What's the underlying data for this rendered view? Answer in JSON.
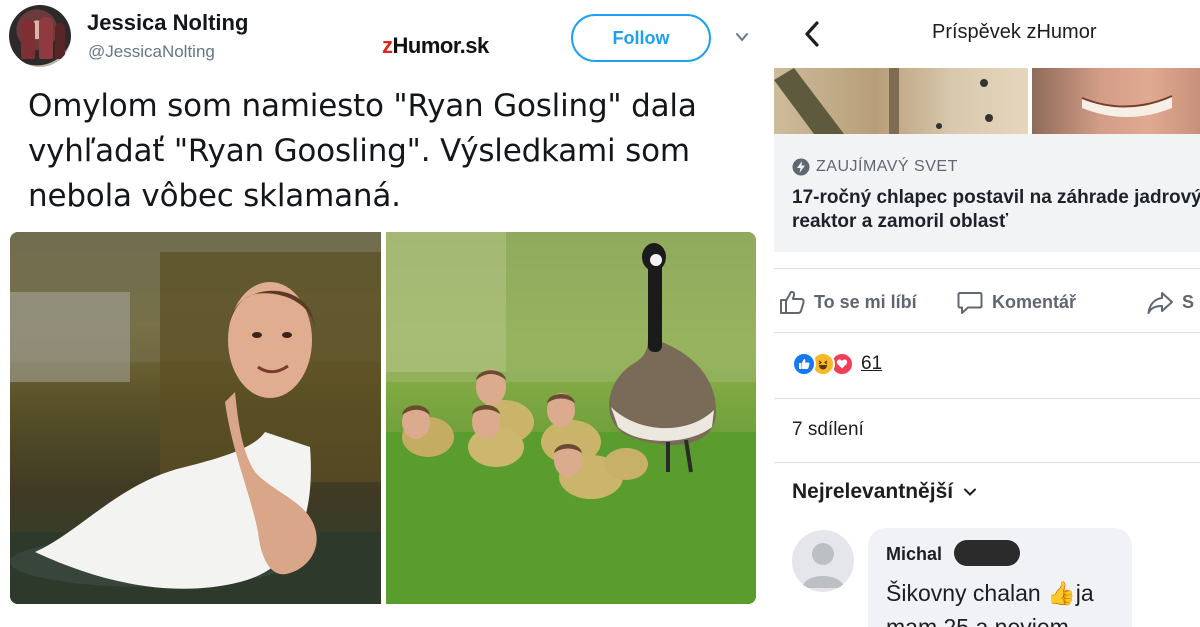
{
  "tweet": {
    "author_name": "Jessica Nolting",
    "author_handle": "@JessicaNolting",
    "follow_label": "Follow",
    "text": "Omylom som namiesto \"Ryan Gosling\" dala vyhľadať \"Ryan Goosling\". Výsledkami som nebola vôbec sklamaná.",
    "images": [
      "goose-with-face",
      "geese-family-with-faces"
    ]
  },
  "watermark": {
    "prefix": "z",
    "rest": "Humor.sk"
  },
  "fb": {
    "header_title": "Príspěvek zHumor",
    "link": {
      "source": "ZAUJÍMAVÝ SVET",
      "title": "17-ročný chlapec postavil na záhrade jadrový reaktor a zamoril oblasť"
    },
    "actions": {
      "like": "To se mi líbí",
      "comment": "Komentář",
      "share": "S"
    },
    "reactions": {
      "count": "61",
      "types": [
        "like",
        "haha",
        "love"
      ]
    },
    "shares": "7 sdílení",
    "sort_label": "Nejrelevantnější",
    "comment": {
      "author": "Michal",
      "text": "Šikovny chalan 👍ja mam 25 a neviem"
    }
  },
  "colors": {
    "twitter_blue": "#1da1f2",
    "fb_blue": "#1877f2",
    "fb_gray": "#606770",
    "fb_card": "#f2f3f5"
  }
}
